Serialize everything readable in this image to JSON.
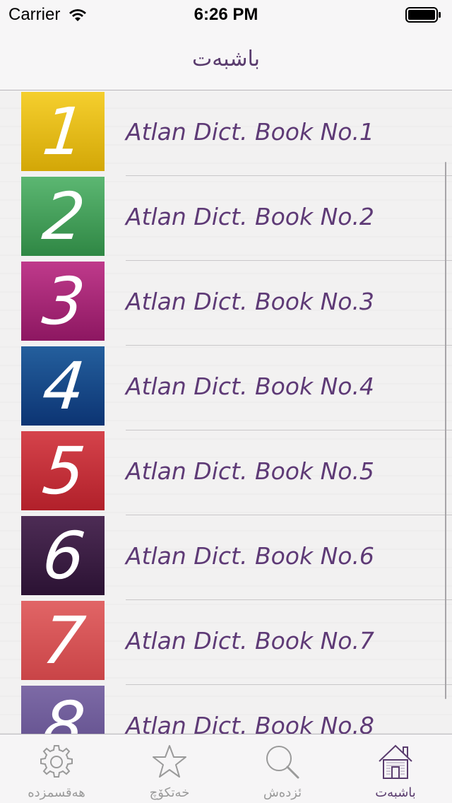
{
  "status_bar": {
    "carrier": "Carrier",
    "time": "6:26 PM"
  },
  "nav": {
    "title": "باشبەت"
  },
  "books": [
    {
      "number": "1",
      "label": "Atlan Dict. Book No.1",
      "color_top": "#f5cf2e",
      "color_bottom": "#d3a707"
    },
    {
      "number": "2",
      "label": "Atlan Dict. Book No.2",
      "color_top": "#5cb772",
      "color_bottom": "#2f8744"
    },
    {
      "number": "3",
      "label": "Atlan Dict. Book No.3",
      "color_top": "#bf3a8b",
      "color_bottom": "#8d1761"
    },
    {
      "number": "4",
      "label": "Atlan Dict. Book No.4",
      "color_top": "#245f9d",
      "color_bottom": "#0c3473"
    },
    {
      "number": "5",
      "label": "Atlan Dict. Book No.5",
      "color_top": "#d5434b",
      "color_bottom": "#b1202a"
    },
    {
      "number": "6",
      "label": "Atlan Dict. Book No.6",
      "color_top": "#4d2c55",
      "color_bottom": "#2b1233"
    },
    {
      "number": "7",
      "label": "Atlan Dict. Book No.7",
      "color_top": "#e16566",
      "color_bottom": "#c94447"
    },
    {
      "number": "8",
      "label": "Atlan Dict. Book No.8",
      "color_top": "#7d6aa6",
      "color_bottom": "#5c4a88"
    }
  ],
  "tabs": [
    {
      "label": "هەقسمزدە",
      "icon": "gear-icon",
      "active": false
    },
    {
      "label": "خەتکۆچ",
      "icon": "star-icon",
      "active": false
    },
    {
      "label": "ئزدەش",
      "icon": "search-icon",
      "active": false
    },
    {
      "label": "باشبەت",
      "icon": "home-icon",
      "active": true
    }
  ],
  "colors": {
    "accent": "#5a3c6e",
    "label_text": "#5e3a76",
    "inactive_tab": "#9a9a9a"
  }
}
